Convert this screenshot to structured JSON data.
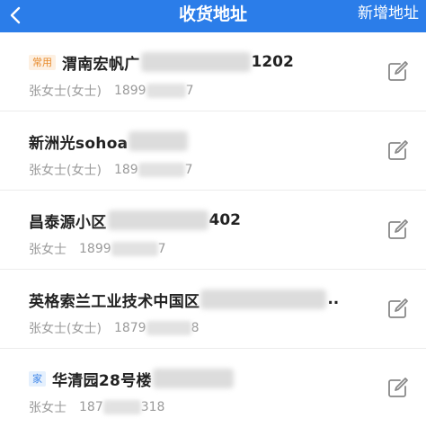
{
  "header": {
    "title": "收货地址",
    "add_label": "新增地址"
  },
  "addresses": [
    {
      "tag": "常用",
      "tag_color": "#e78a2b",
      "addr_head": "渭南宏帆广",
      "addr_tail": "1202",
      "name": "张女士(女士)",
      "phone_head": "1899",
      "phone_tail": "7"
    },
    {
      "tag": "",
      "addr_head": "新洲光sohoa",
      "addr_tail": "",
      "name": "张女士(女士)",
      "phone_head": "189",
      "phone_tail": "7"
    },
    {
      "tag": "",
      "addr_head": "昌泰源小区",
      "addr_tail": "402",
      "name": "张女士",
      "phone_head": "1899",
      "phone_tail": "7"
    },
    {
      "tag": "",
      "addr_head": "英格索兰工业技术中国区",
      "addr_tail": "..",
      "name": "张女士(女士)",
      "phone_head": "1879",
      "phone_tail": "8"
    },
    {
      "tag": "家",
      "tag_color": "#3f86e8",
      "addr_head": "华清园28号楼",
      "addr_tail": "",
      "name": "张女士",
      "phone_head": "187",
      "phone_tail": "318"
    }
  ],
  "icons": {
    "back": "chevron-left-icon",
    "edit": "edit-icon"
  },
  "colors": {
    "header_bg": "#2b7de9",
    "text_primary": "#222222",
    "text_secondary": "#9a9a9a"
  }
}
